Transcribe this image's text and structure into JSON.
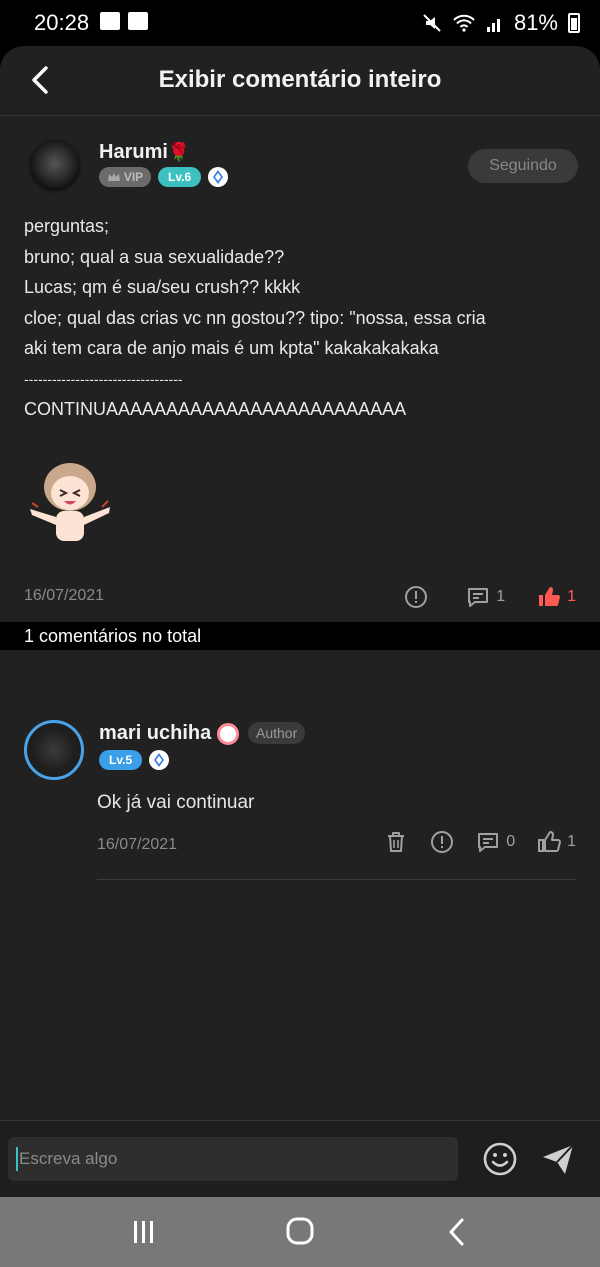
{
  "status": {
    "time": "20:28",
    "battery": "81%"
  },
  "header": {
    "title": "Exibir comentário inteiro"
  },
  "post": {
    "username": "Harumi",
    "username_emoji": "🌹",
    "vip_label": "VIP",
    "level_label": "Lv.6",
    "follow_label": "Seguindo",
    "lines": [
      "perguntas;",
      "bruno; qual a sua sexualidade??",
      "Lucas; qm é sua/seu crush?? kkkk",
      "cloe; qual das crias vc nn gostou?? tipo: \"nossa, essa cria",
      "aki tem cara de anjo mais é um kpta\" kakakakakaka",
      "----------------------------------",
      "CONTINUAAAAAAAAAAAAAAAAAAAAAAAAA"
    ],
    "date": "16/07/2021",
    "reply_count": "1",
    "like_count": "1"
  },
  "comments_total": "1 comentários no total",
  "comment": {
    "username": "mari uchiha",
    "author_label": "Author",
    "level_label": "Lv.5",
    "text": "Ok já vai continuar",
    "date": "16/07/2021",
    "reply_count": "0",
    "like_count": "1"
  },
  "input": {
    "placeholder": "Escreva algo"
  },
  "colors": {
    "background": "#212121",
    "like_active": "#ff5a52",
    "level_teal": "#3cc0c0",
    "level_blue": "#3a9ee8"
  },
  "icons": [
    "back-arrow-icon",
    "report-icon",
    "reply-icon",
    "thumbs-up-icon",
    "trash-icon",
    "emoji-icon",
    "send-icon"
  ]
}
